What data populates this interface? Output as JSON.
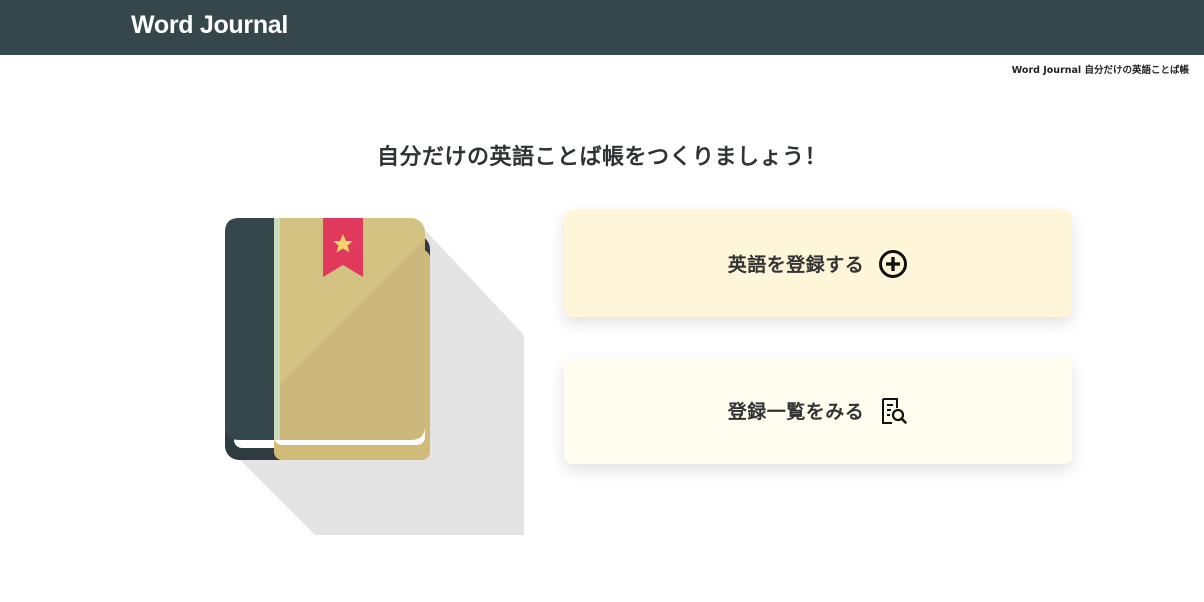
{
  "header": {
    "brand": "Word Journal"
  },
  "breadcrumb": {
    "text": "Word Journal 自分だけの英語ことば帳"
  },
  "main": {
    "headline": "自分だけの英語ことば帳をつくりましょう！",
    "actions": [
      {
        "label": "英語を登録する",
        "icon": "plus-circle-icon"
      },
      {
        "label": "登録一覧をみる",
        "icon": "document-search-icon"
      }
    ]
  },
  "colors": {
    "header_bg": "#36474b",
    "card_register_bg": "#fff6d9",
    "card_list_bg": "#fffcf0",
    "book_cover": "#d4c283",
    "book_spine": "#36474b",
    "bookmark": "#e0395c",
    "star": "#f3d36b"
  }
}
